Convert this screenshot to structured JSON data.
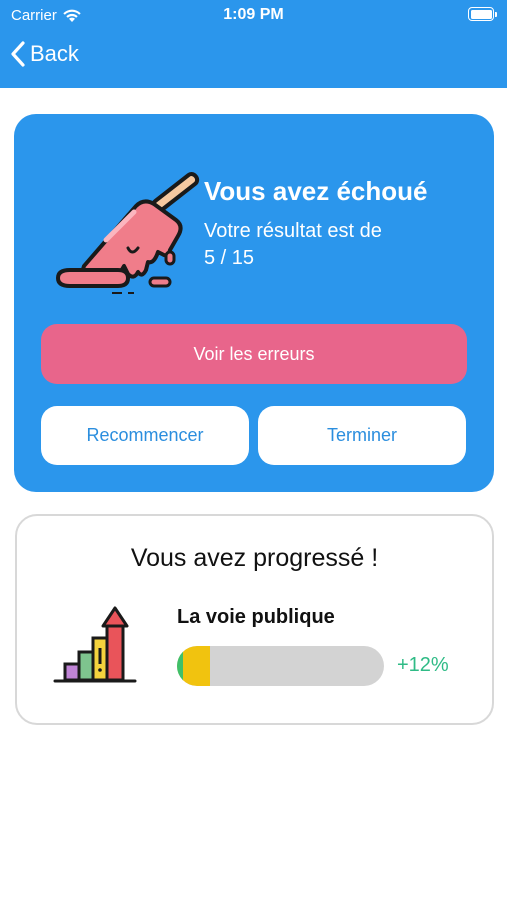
{
  "status_bar": {
    "carrier": "Carrier",
    "time": "1:09 PM"
  },
  "nav": {
    "back_label": "Back"
  },
  "result": {
    "title": "Vous avez échoué",
    "score_text": "Votre résultat est de",
    "score": "5 / 15",
    "errors_button": "Voir les erreurs",
    "restart_button": "Recommencer",
    "finish_button": "Terminer"
  },
  "progress": {
    "title": "Vous avez progressé !",
    "topic": "La voie publique",
    "fraction": 0.16,
    "delta": "+12%"
  },
  "colors": {
    "primary": "#2b96ec",
    "accent_pink": "#e8658b",
    "progress_fill": "#f1c30f",
    "delta_green": "#2fbb86"
  },
  "icons": {
    "result": "melting-popsicle-icon",
    "progress": "growth-bar-chart-icon"
  }
}
